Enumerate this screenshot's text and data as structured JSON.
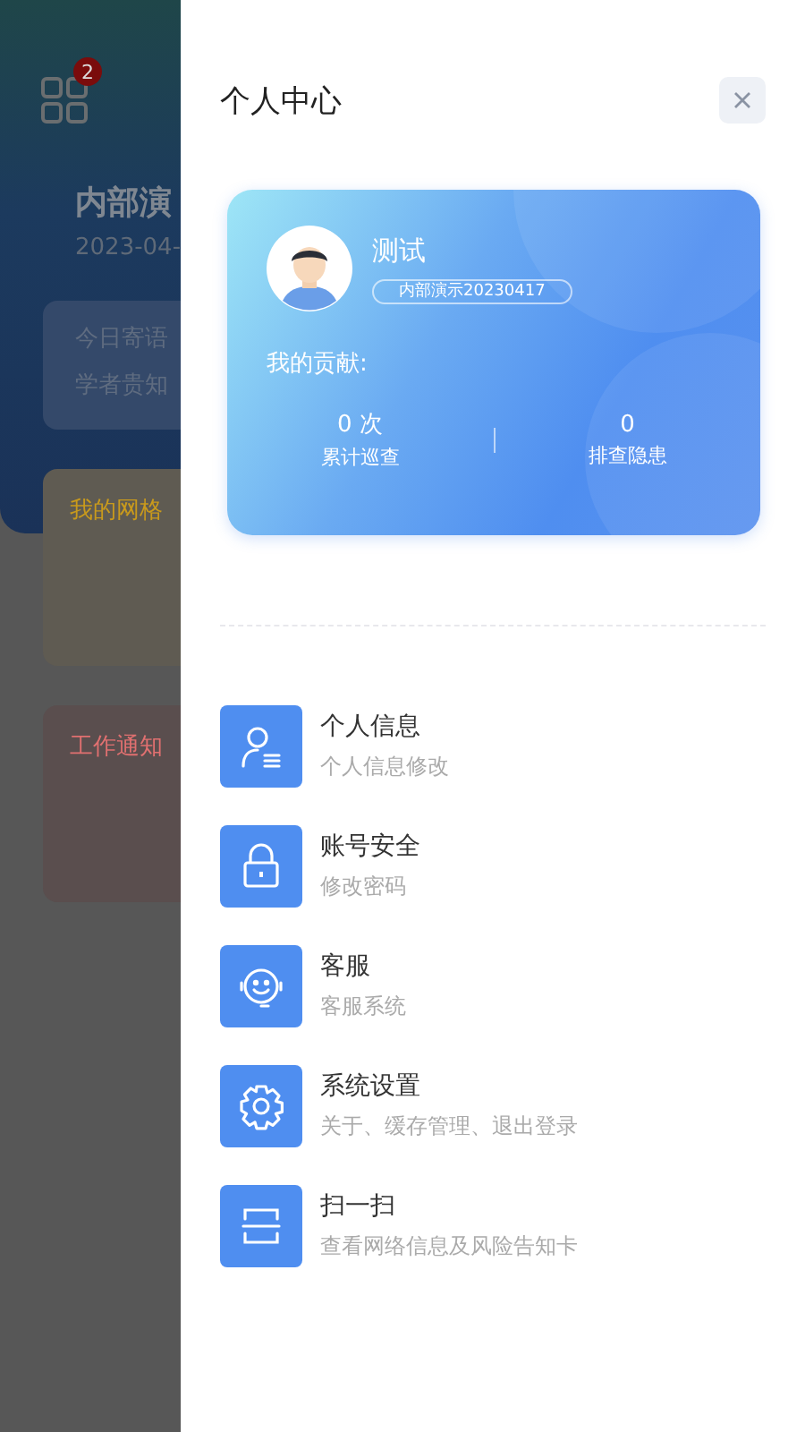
{
  "background": {
    "badge": "2",
    "title": "内部演",
    "date": "2023-04-",
    "quote_label": "今日寄语",
    "quote": "学者贵知",
    "grid_label": "我的网格",
    "notice_label": "工作通知"
  },
  "drawer": {
    "title": "个人中心",
    "profile": {
      "name": "测试",
      "tag": "内部演示20230417",
      "contribution_label": "我的贡献:",
      "stats": [
        {
          "value": "0 次",
          "label": "累计巡查"
        },
        {
          "value": "0",
          "label": "排查隐患"
        }
      ]
    },
    "menu": [
      {
        "kind": "person",
        "title": "个人信息",
        "subtitle": "个人信息修改"
      },
      {
        "kind": "lock",
        "title": "账号安全",
        "subtitle": "修改密码"
      },
      {
        "kind": "service",
        "title": "客服",
        "subtitle": "客服系统"
      },
      {
        "kind": "gear",
        "title": "系统设置",
        "subtitle": "关于、缓存管理、退出登录"
      },
      {
        "kind": "scan",
        "title": "扫一扫",
        "subtitle": "查看网络信息及风险告知卡"
      }
    ]
  }
}
